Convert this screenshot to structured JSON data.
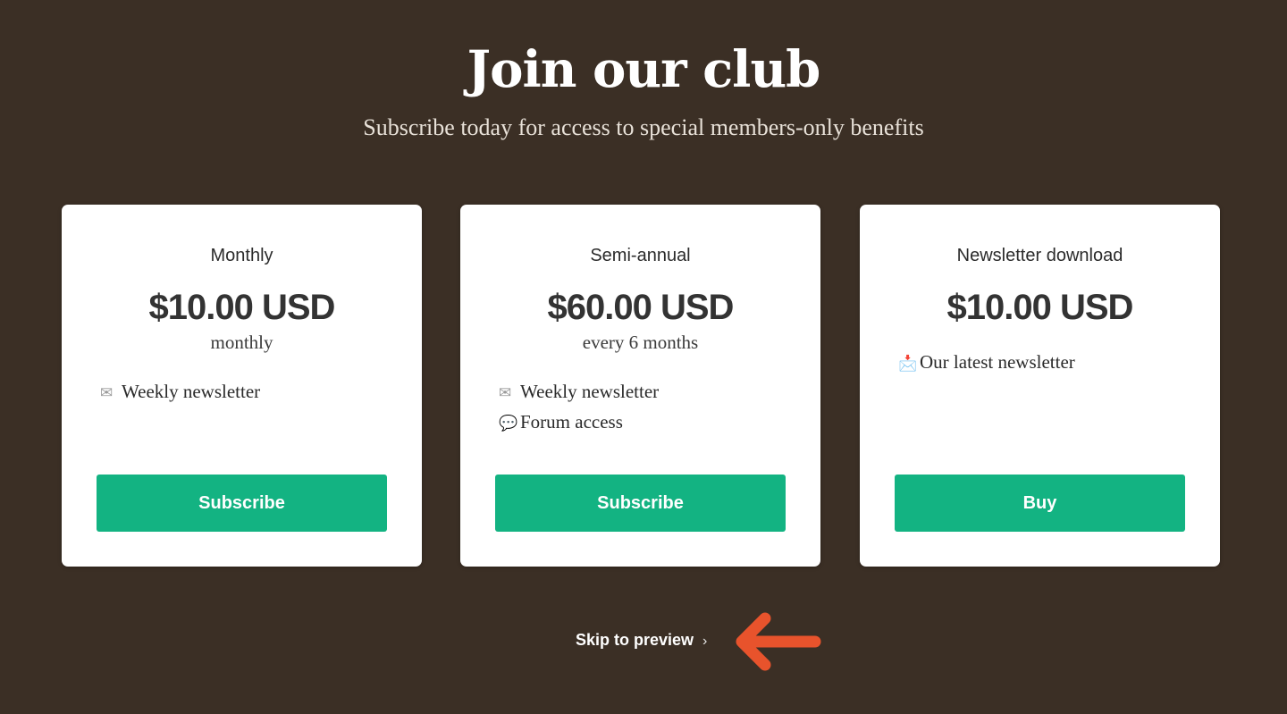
{
  "header": {
    "title": "Join our club",
    "subtitle": "Subscribe today for access to special members-only benefits"
  },
  "plans": [
    {
      "name": "Monthly",
      "price": "$10.00 USD",
      "period": "monthly",
      "benefits": [
        {
          "icon": "envelope-icon",
          "glyph": "✉",
          "label": "Weekly newsletter"
        }
      ],
      "button_label": "Subscribe"
    },
    {
      "name": "Semi-annual",
      "price": "$60.00 USD",
      "period": "every 6 months",
      "benefits": [
        {
          "icon": "envelope-icon",
          "glyph": "✉",
          "label": "Weekly newsletter"
        },
        {
          "icon": "speech-bubble-icon",
          "glyph": "💬",
          "label": "Forum access"
        }
      ],
      "button_label": "Subscribe"
    },
    {
      "name": "Newsletter download",
      "price": "$10.00 USD",
      "period": "",
      "benefits": [
        {
          "icon": "incoming-envelope-icon",
          "glyph": "📩",
          "label": "Our latest newsletter"
        }
      ],
      "button_label": "Buy"
    }
  ],
  "skip_link": {
    "label": "Skip to preview",
    "chevron": "›"
  },
  "colors": {
    "background": "#3b2f25",
    "card": "#ffffff",
    "button": "#13b382",
    "annotation_arrow": "#e8532c"
  }
}
